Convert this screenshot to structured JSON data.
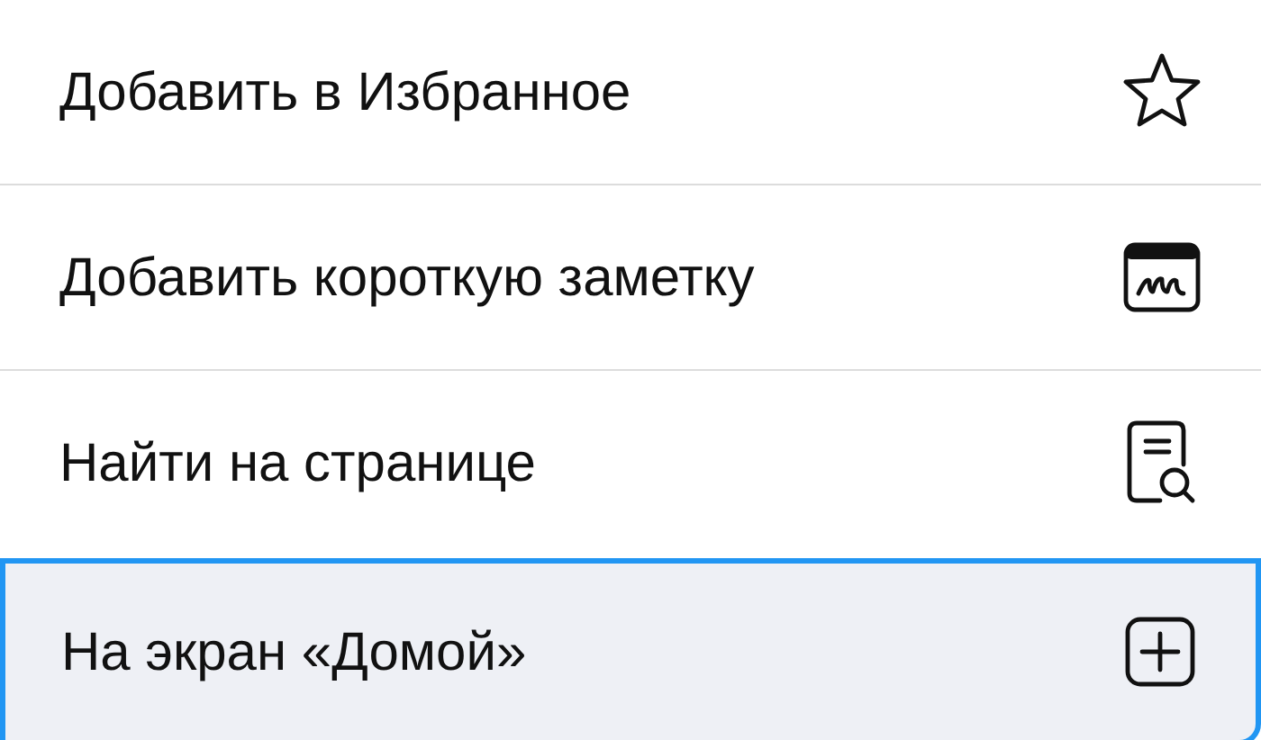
{
  "menu": {
    "items": [
      {
        "label": "Добавить в Избранное",
        "kind": "star",
        "selected": false
      },
      {
        "label": "Добавить короткую заметку",
        "kind": "note",
        "selected": false
      },
      {
        "label": "Найти на странице",
        "kind": "find",
        "selected": false
      },
      {
        "label": "На экран «Домой»",
        "kind": "add",
        "selected": true
      }
    ]
  }
}
